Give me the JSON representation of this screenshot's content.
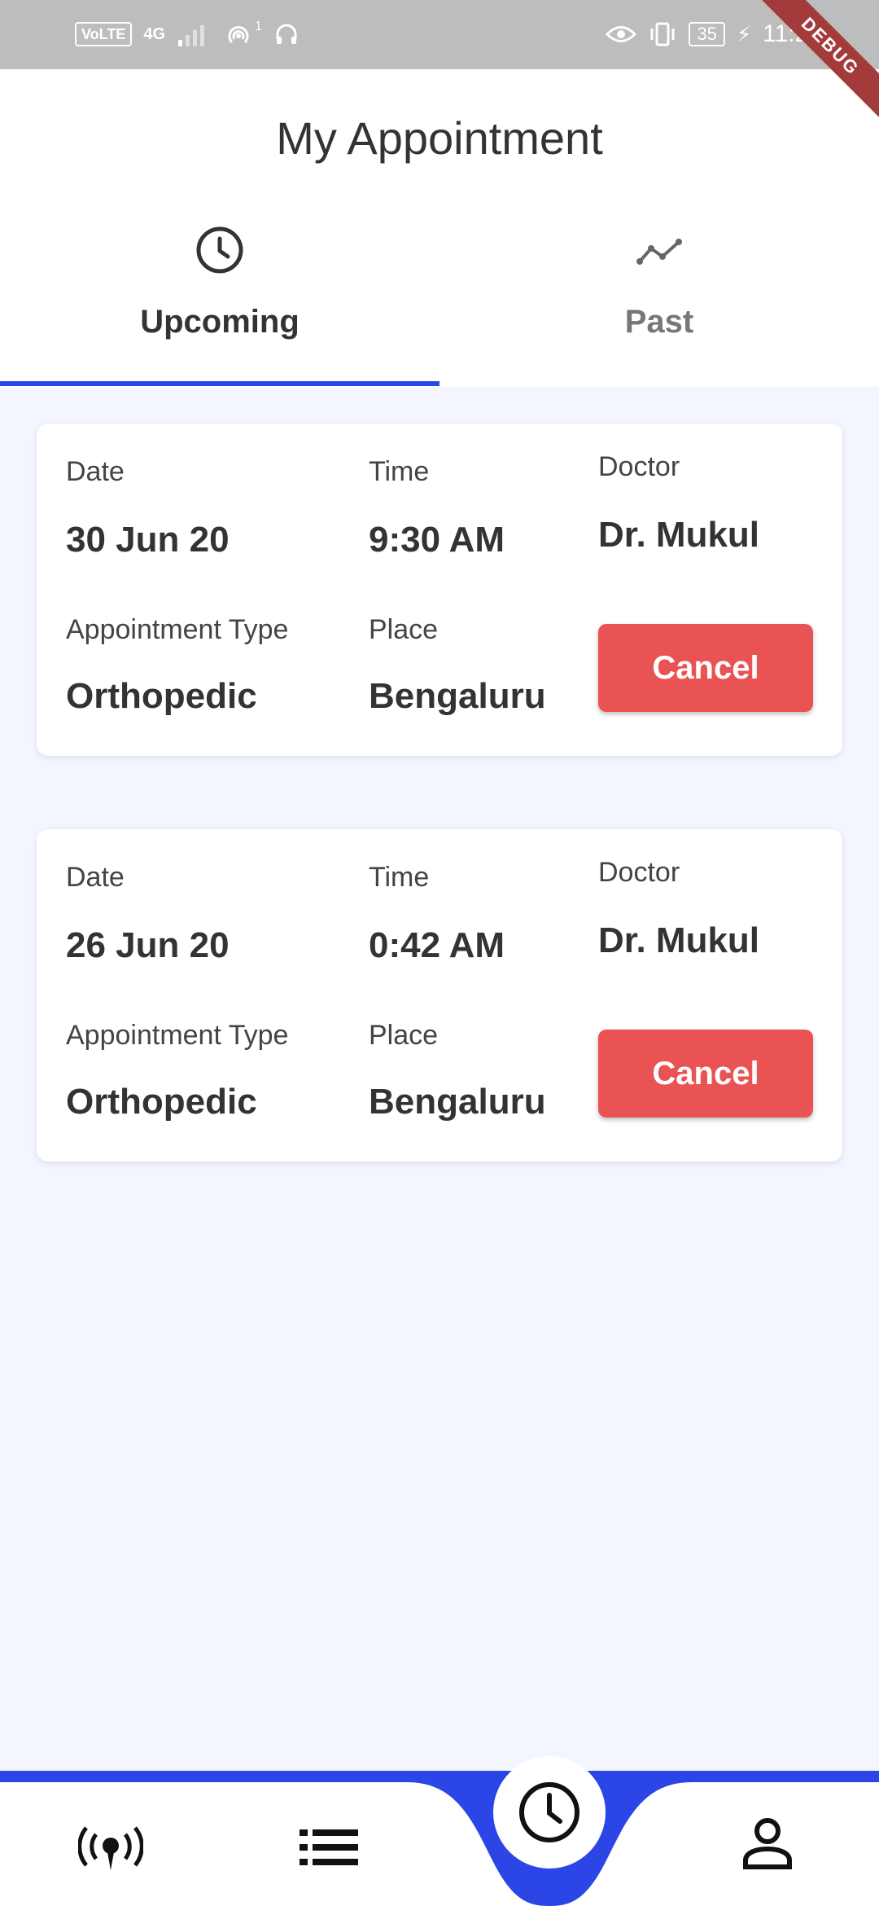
{
  "status_bar": {
    "volte": "VoLTE",
    "network": "4G",
    "hotspot_count": "1",
    "battery": "35",
    "time": "11:26",
    "debug": "DEBUG"
  },
  "header": {
    "title": "My Appointment"
  },
  "tabs": [
    {
      "label": "Upcoming",
      "icon": "clock-icon",
      "selected": true
    },
    {
      "label": "Past",
      "icon": "trend-line-icon",
      "selected": false
    }
  ],
  "labels": {
    "date": "Date",
    "time": "Time",
    "doctor": "Doctor",
    "appointment_type": "Appointment Type",
    "place": "Place",
    "cancel": "Cancel"
  },
  "appointments": [
    {
      "date": "30 Jun 20",
      "time": "9:30 AM",
      "doctor": "Dr. Mukul",
      "type": "Orthopedic",
      "place": "Bengaluru"
    },
    {
      "date": "26 Jun 20",
      "time": "0:42 AM",
      "doctor": "Dr. Mukul",
      "type": "Orthopedic",
      "place": "Bengaluru"
    }
  ],
  "bottom_nav": {
    "items": [
      "broadcast-icon",
      "list-icon",
      "clock-icon",
      "person-icon"
    ],
    "accent": "#2c45e6"
  },
  "colors": {
    "accent": "#2c45e6",
    "cancel": "#ea5353",
    "background": "#f3f6fe"
  }
}
